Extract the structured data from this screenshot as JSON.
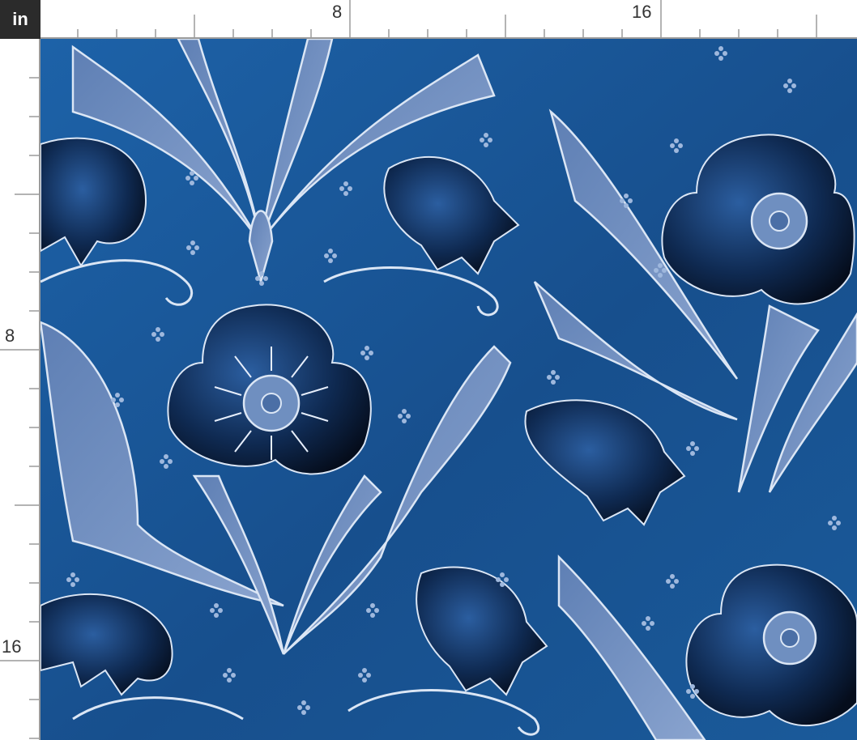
{
  "unit": "in",
  "ruler_top": {
    "labels": [
      "8",
      "16"
    ]
  },
  "ruler_left": {
    "labels": [
      "8",
      "16"
    ]
  },
  "palette": {
    "background": "#1a5a9a",
    "leaf": "#6f8fc0",
    "outline": "#dbe6f5",
    "petal_dark": "#0a1a33",
    "petal_mid": "#1f4c86",
    "dots": "#9fb8dd"
  }
}
